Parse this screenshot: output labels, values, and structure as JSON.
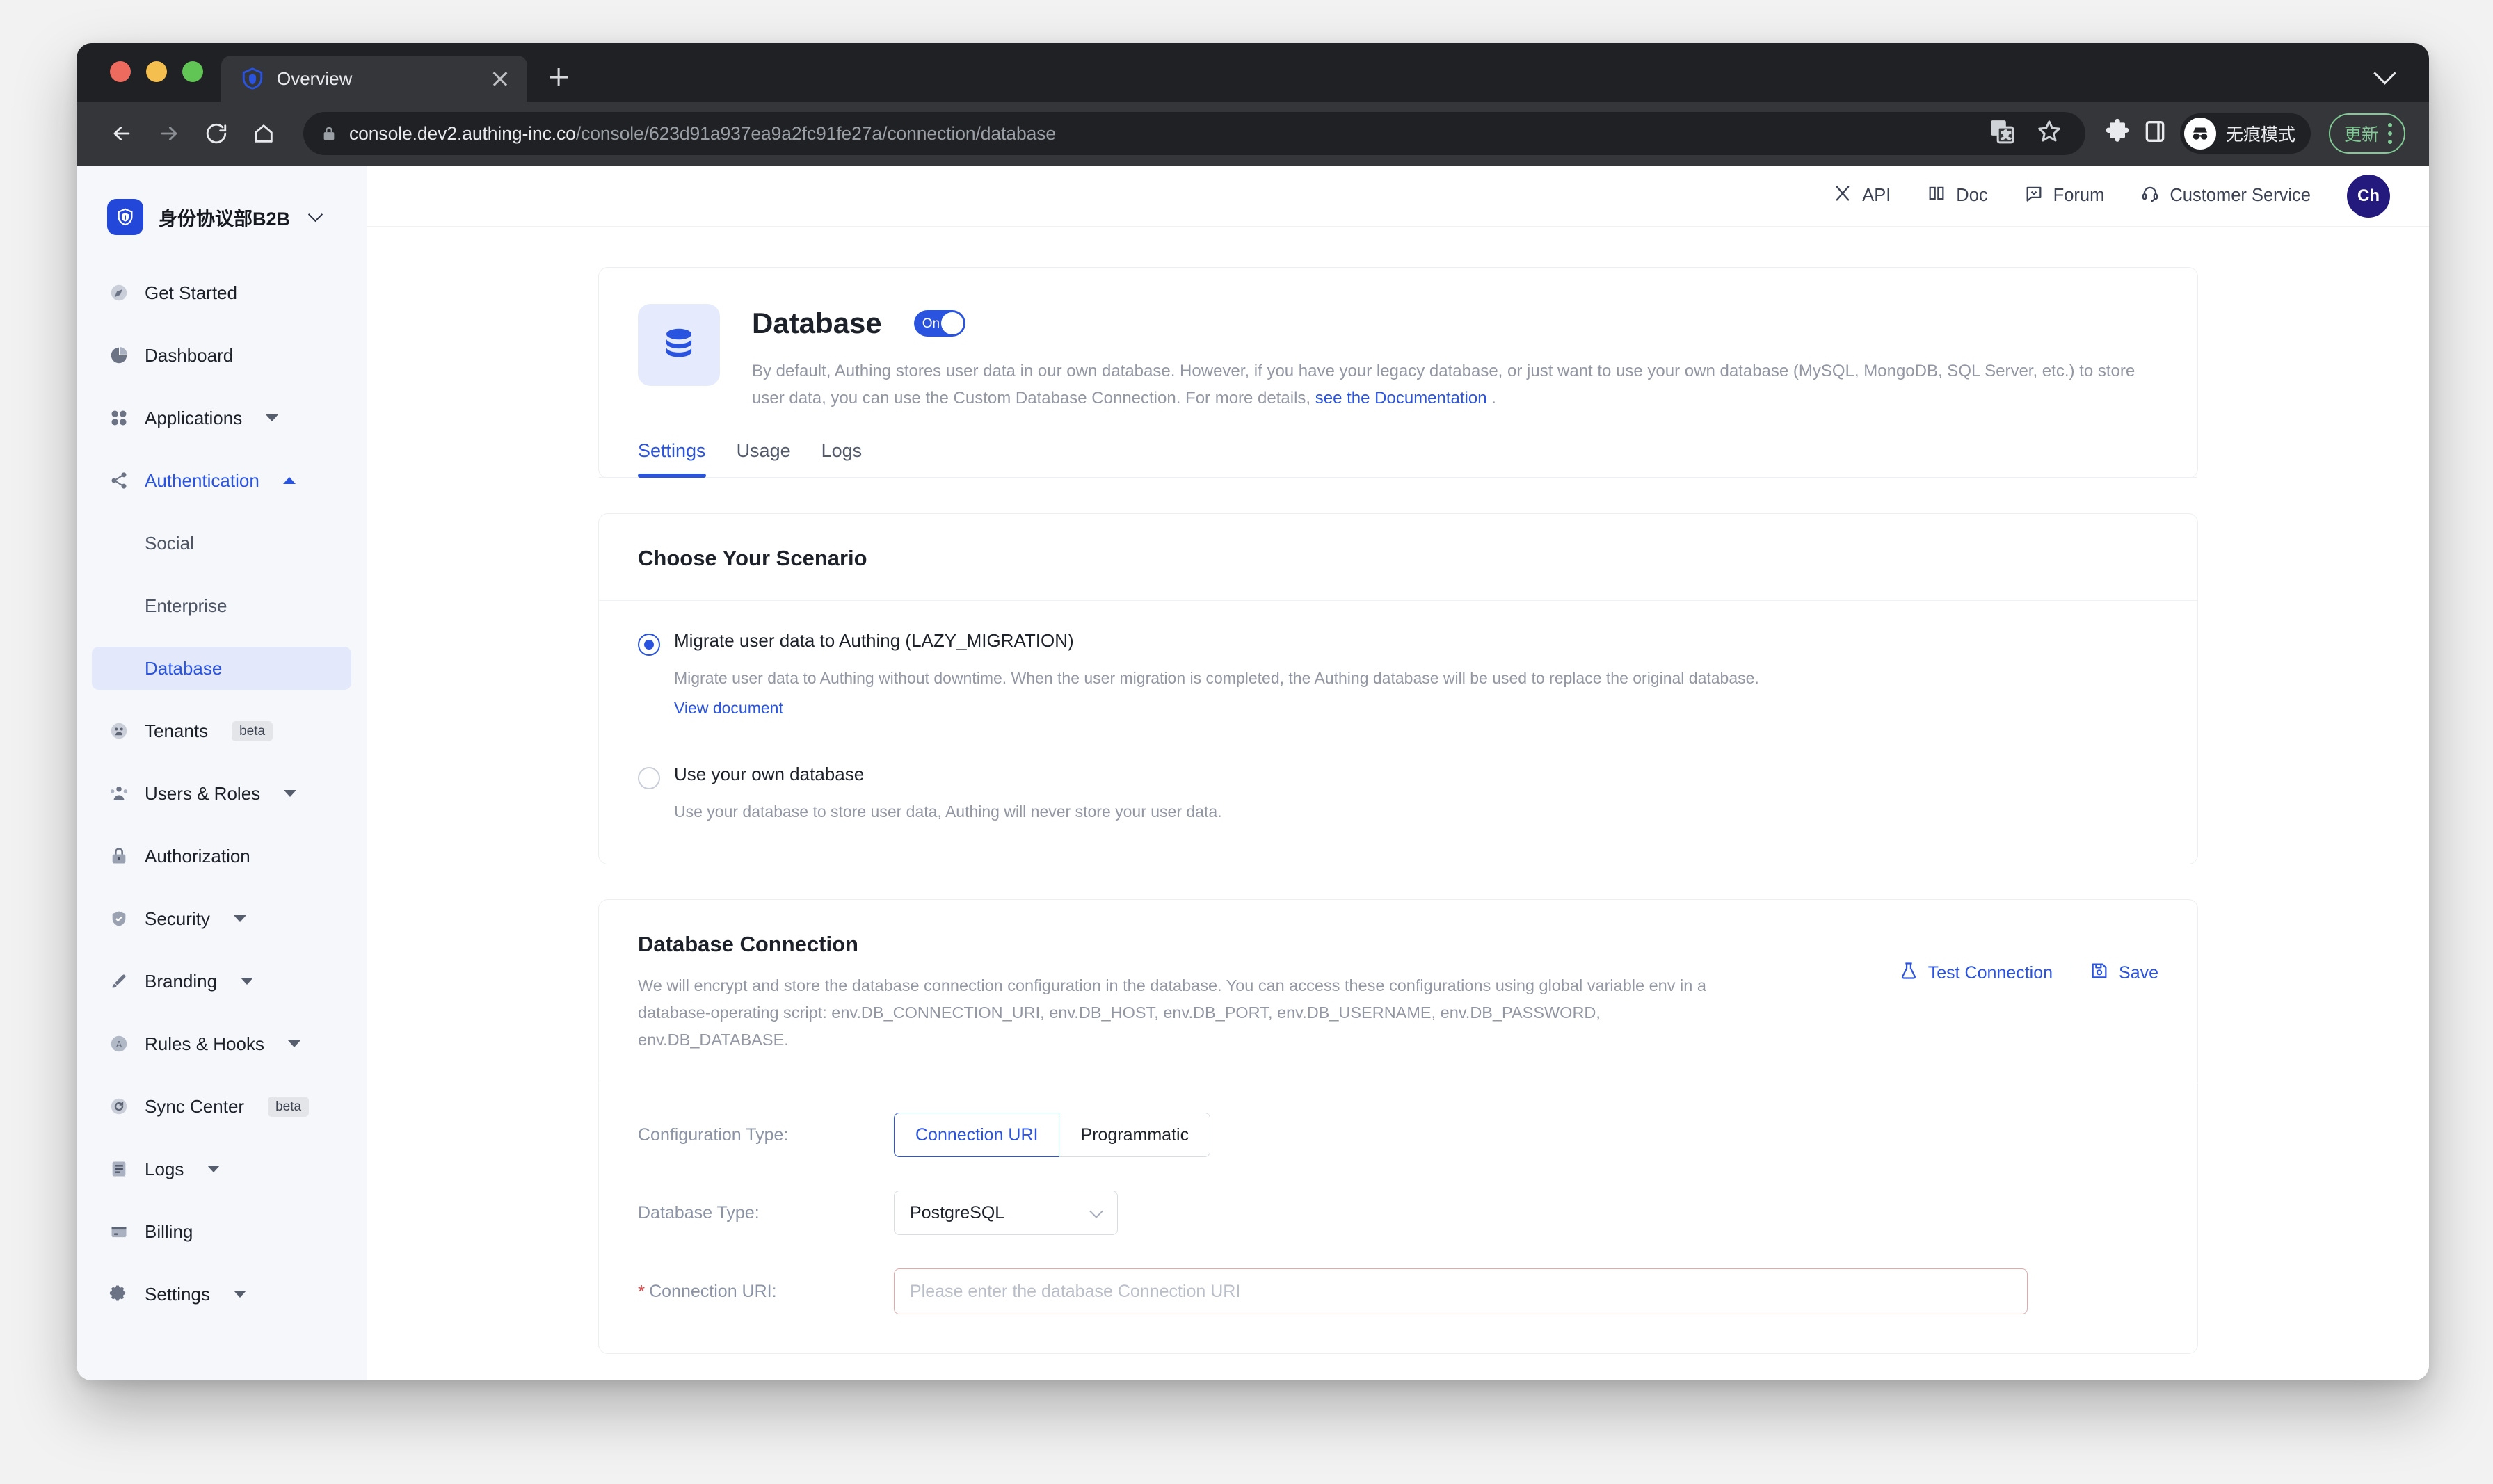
{
  "browser": {
    "tab_title": "Overview",
    "url_host": "console.dev2.authing-inc.co",
    "url_path": "/console/623d91a937ea9a2fc91fe27a/connection/database",
    "incognito_label": "无痕模式",
    "update_label": "更新"
  },
  "sidebar": {
    "org_name": "身份协议部B2B",
    "items": [
      {
        "label": "Get Started",
        "icon": "compass-icon"
      },
      {
        "label": "Dashboard",
        "icon": "pie-chart-icon"
      },
      {
        "label": "Applications",
        "icon": "grid-icon",
        "expandable": true
      },
      {
        "label": "Authentication",
        "icon": "share-nodes-icon",
        "expandable": true,
        "expanded": true,
        "active": true
      },
      {
        "label": "Tenants",
        "icon": "tenants-icon",
        "badge": "beta"
      },
      {
        "label": "Users & Roles",
        "icon": "users-icon",
        "expandable": true
      },
      {
        "label": "Authorization",
        "icon": "lock-icon"
      },
      {
        "label": "Security",
        "icon": "shield-check-icon",
        "expandable": true
      },
      {
        "label": "Branding",
        "icon": "brush-icon",
        "expandable": true
      },
      {
        "label": "Rules & Hooks",
        "icon": "rules-icon",
        "expandable": true
      },
      {
        "label": "Sync Center",
        "icon": "sync-icon",
        "badge": "beta"
      },
      {
        "label": "Logs",
        "icon": "logs-icon",
        "expandable": true
      },
      {
        "label": "Billing",
        "icon": "billing-icon"
      },
      {
        "label": "Settings",
        "icon": "gear-icon",
        "expandable": true
      }
    ],
    "sub_items": [
      {
        "label": "Social"
      },
      {
        "label": "Enterprise"
      },
      {
        "label": "Database",
        "selected": true
      }
    ]
  },
  "app_header": {
    "items": [
      {
        "label": "API",
        "icon": "api-icon"
      },
      {
        "label": "Doc",
        "icon": "book-icon"
      },
      {
        "label": "Forum",
        "icon": "comment-icon"
      },
      {
        "label": "Customer Service",
        "icon": "headset-icon"
      }
    ],
    "avatar_initials": "Ch"
  },
  "overview": {
    "title": "Database",
    "icon": "database-icon",
    "toggle_label": "On",
    "toggle_on": true,
    "description_part1": "By default, Authing stores user data in our own database. However, if you have your legacy database, or just want to use your own database (MySQL, MongoDB, SQL Server, etc.) to store user data, you can use the Custom Database Connection. For more details, ",
    "description_link": "see the Documentation",
    "description_part2": " .",
    "tabs": [
      {
        "label": "Settings",
        "active": true
      },
      {
        "label": "Usage",
        "active": false
      },
      {
        "label": "Logs",
        "active": false
      }
    ]
  },
  "scenario": {
    "title": "Choose Your Scenario",
    "options": [
      {
        "label": "Migrate user data to Authing (LAZY_MIGRATION)",
        "checked": true,
        "description": "Migrate user data to Authing without downtime. When the user migration is completed, the Authing database will be used to replace the original database.",
        "link": "View document"
      },
      {
        "label": "Use your own database",
        "checked": false,
        "description": "Use your database to store user data, Authing will never store your user data.",
        "link": ""
      }
    ]
  },
  "connection": {
    "title": "Database Connection",
    "description": "We will encrypt and store the database connection configuration in the database. You can access these configurations using global variable env in a database-operating script: env.DB_CONNECTION_URI, env.DB_HOST, env.DB_PORT, env.DB_USERNAME, env.DB_PASSWORD, env.DB_DATABASE.",
    "test_button": "Test Connection",
    "save_button": "Save",
    "form": {
      "config_type_label": "Configuration Type:",
      "config_type_options": [
        "Connection URI",
        "Programmatic"
      ],
      "config_type_selected": "Connection URI",
      "database_type_label": "Database Type:",
      "database_type_value": "PostgreSQL",
      "connection_uri_label": "Connection URI:",
      "connection_uri_required": "*",
      "connection_uri_value": "",
      "connection_uri_placeholder": "Please enter the database Connection URI"
    }
  },
  "colors": {
    "accent": "#2a54e0",
    "sidebar_bg": "#f5f7fa",
    "selected_bg": "#e3e9fb",
    "required_red": "#e04a4a"
  }
}
